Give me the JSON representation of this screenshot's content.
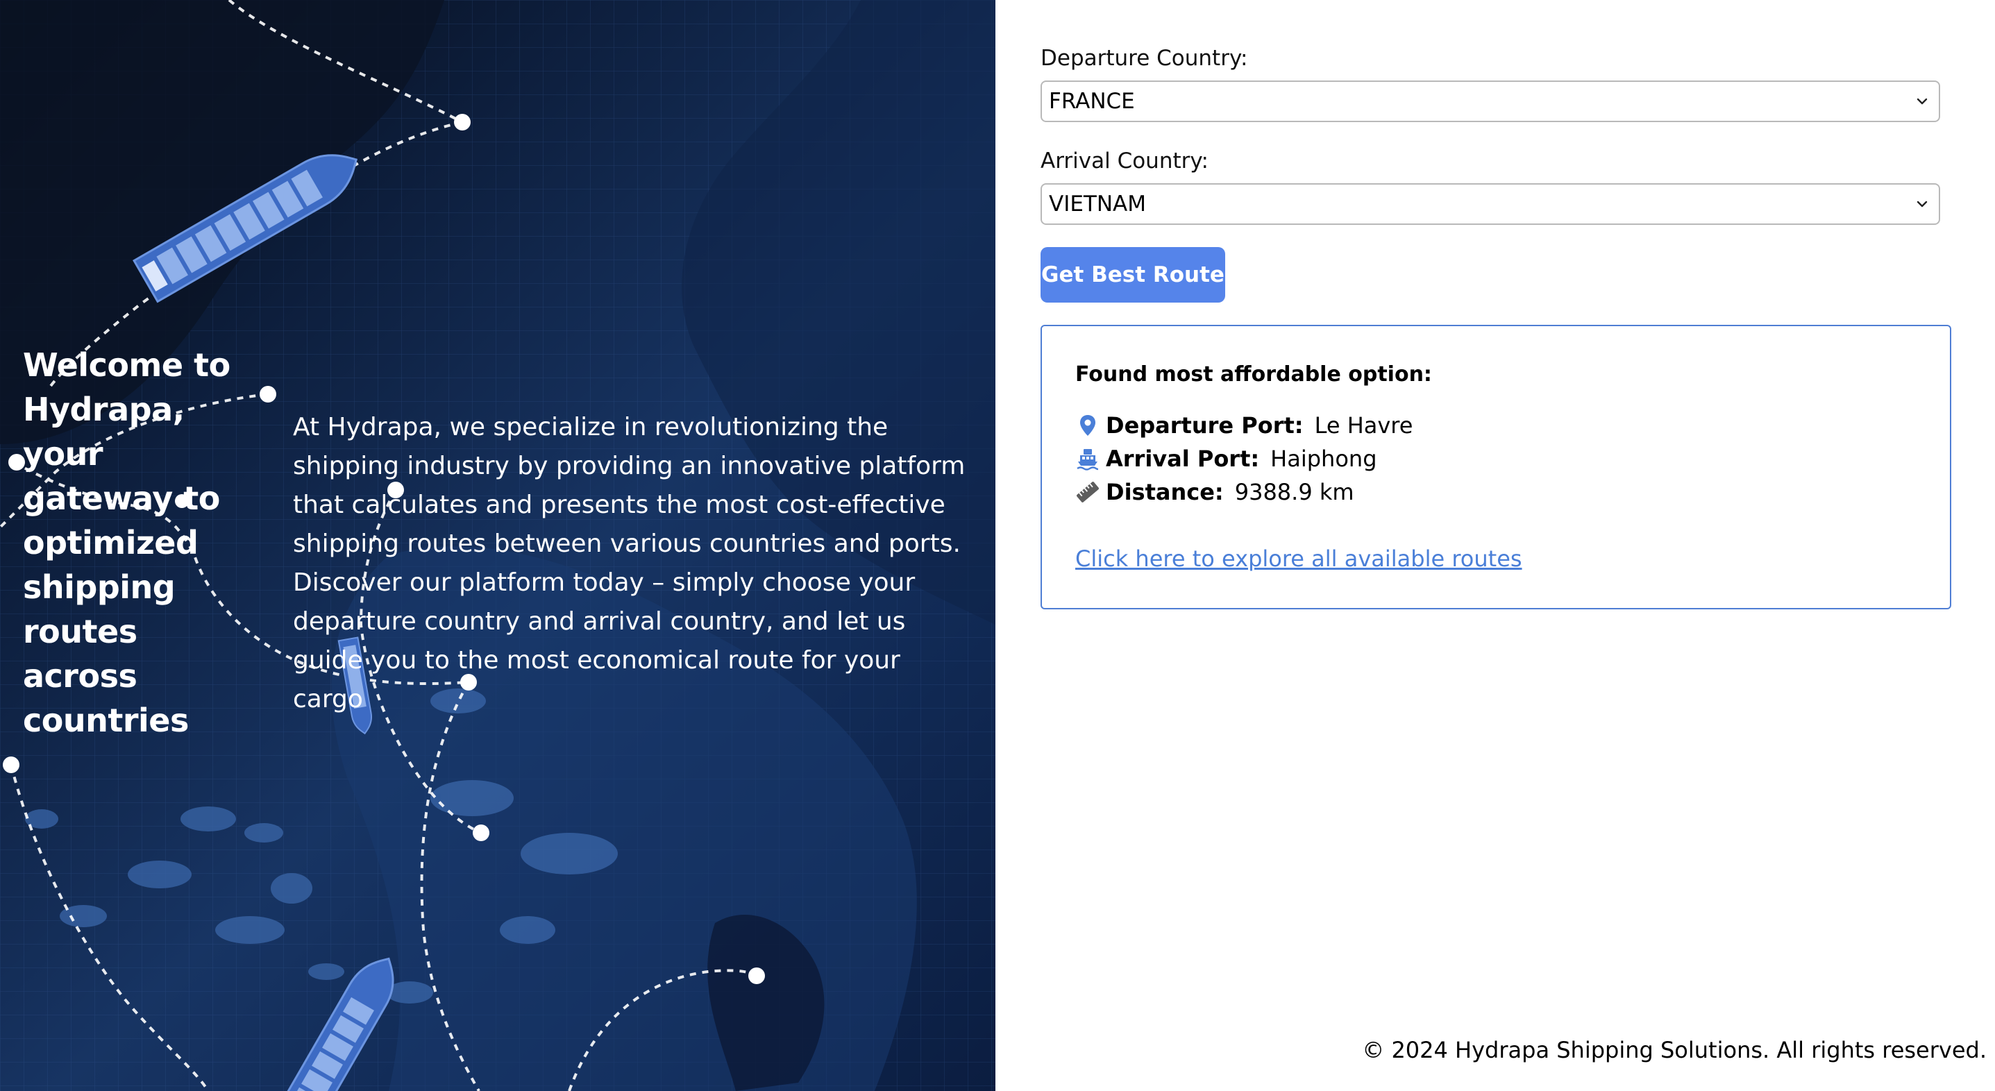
{
  "hero": {
    "title": "Welcome to Hydrapa, your gateway to optimized shipping routes across countries",
    "description": "At Hydrapa, we specialize in revolutionizing the shipping industry by providing an innovative platform that calculates and presents the most cost-effective shipping routes between various countries and ports. Discover our platform today – simply choose your departure country and arrival country, and let us guide you to the most economical route for your cargo",
    "background_icons": [
      "container-ship-icon",
      "route-node-icon",
      "world-map-graphic"
    ]
  },
  "form": {
    "departure_label": "Departure Country:",
    "departure_value": "FRANCE",
    "arrival_label": "Arrival Country:",
    "arrival_value": "VIETNAM",
    "submit_label": "Get Best Route",
    "button_color": "#5584ea"
  },
  "result": {
    "title": "Found most affordable option:",
    "departure_port_label": "Departure Port:",
    "departure_port_value": "Le Havre",
    "arrival_port_label": "Arrival Port:",
    "arrival_port_value": "Haiphong",
    "distance_label": "Distance:",
    "distance_value": "9388.9 km",
    "explore_link": "Click here to explore all available routes",
    "accent_color": "#4f7ed4",
    "icons": [
      "map-pin-icon",
      "ship-icon",
      "ruler-icon"
    ]
  },
  "footer": {
    "copyright": "© 2024 Hydrapa Shipping Solutions. All rights reserved."
  }
}
